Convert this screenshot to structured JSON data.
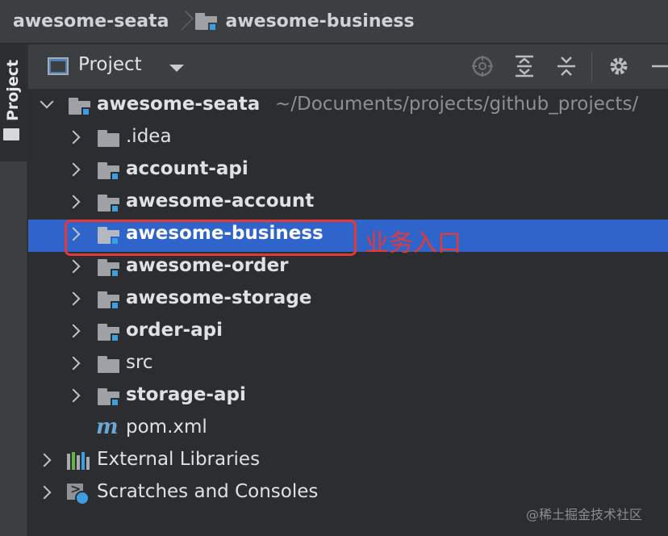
{
  "breadcrumb": {
    "items": [
      "awesome-seata",
      "awesome-business"
    ]
  },
  "tool_stripe": {
    "label": "Project"
  },
  "panel": {
    "title": "Project",
    "tools": [
      "locate-icon",
      "expand-all-icon",
      "collapse-all-icon",
      "gear-icon",
      "minimize-icon"
    ]
  },
  "tree": {
    "root": {
      "label": "awesome-seata",
      "path": "~/Documents/projects/github_projects/"
    },
    "children": [
      {
        "label": ".idea",
        "module": false
      },
      {
        "label": "account-api",
        "module": true
      },
      {
        "label": "awesome-account",
        "module": true
      },
      {
        "label": "awesome-business",
        "module": true,
        "selected": true
      },
      {
        "label": "awesome-order",
        "module": true
      },
      {
        "label": "awesome-storage",
        "module": true
      },
      {
        "label": "order-api",
        "module": true
      },
      {
        "label": "src",
        "module": false
      },
      {
        "label": "storage-api",
        "module": true
      },
      {
        "label": "pom.xml",
        "module": false
      }
    ],
    "external_libraries": "External Libraries",
    "scratches": "Scratches and Consoles"
  },
  "annotation": {
    "text": "业务入口",
    "color": "#e53935"
  },
  "watermark": "@稀土掘金技术社区",
  "colors": {
    "selection": "#2f65ca",
    "module_marker": "#3d9ee4",
    "background": "#2b2d30"
  }
}
